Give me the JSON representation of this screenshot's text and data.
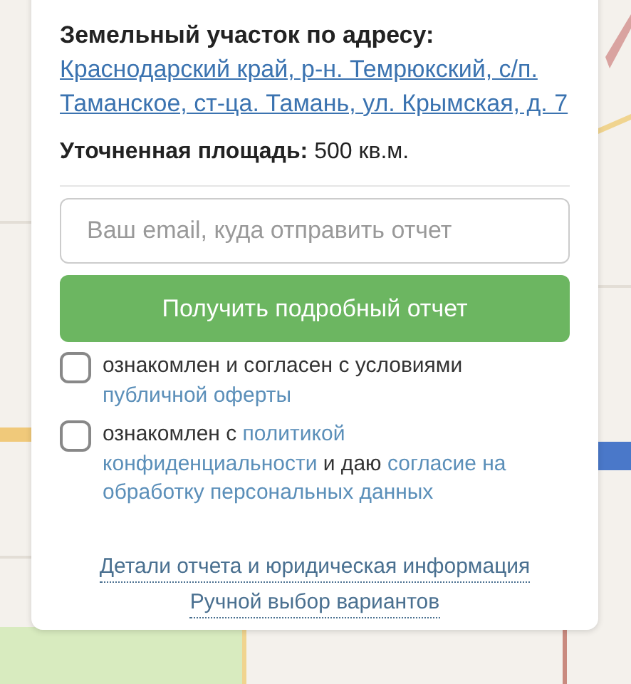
{
  "card": {
    "address_label": "Земельный участок по адресу:",
    "address": "Краснодарский край, р-н. Темрюкский, с/п. Таманское, ст-ца. Тамань, ул. Крымская, д. 7",
    "area_label": "Уточненная площадь:",
    "area_value": "500 кв.м.",
    "email": {
      "placeholder": "Ваш email, куда отправить отчет"
    },
    "submit": "Получить подробный отчет",
    "consents": [
      {
        "checked": false,
        "parts": [
          {
            "text": "ознакомлен и согласен с условиями",
            "link": false
          },
          {
            "text": "публичной оферты",
            "link": true
          }
        ]
      },
      {
        "checked": false,
        "parts": [
          {
            "text": "ознакомлен с",
            "link": false
          },
          {
            "text": "политикой",
            "link": true
          },
          {
            "text": "конфиденциальности",
            "link": true
          },
          {
            "text": "и даю",
            "link": false
          },
          {
            "text": "согласие на",
            "link": true
          },
          {
            "text": "обработку персональных данных",
            "link": true
          }
        ]
      }
    ],
    "links": [
      "Детали отчета и юридическая информация",
      "Ручной выбор вариантов"
    ]
  }
}
